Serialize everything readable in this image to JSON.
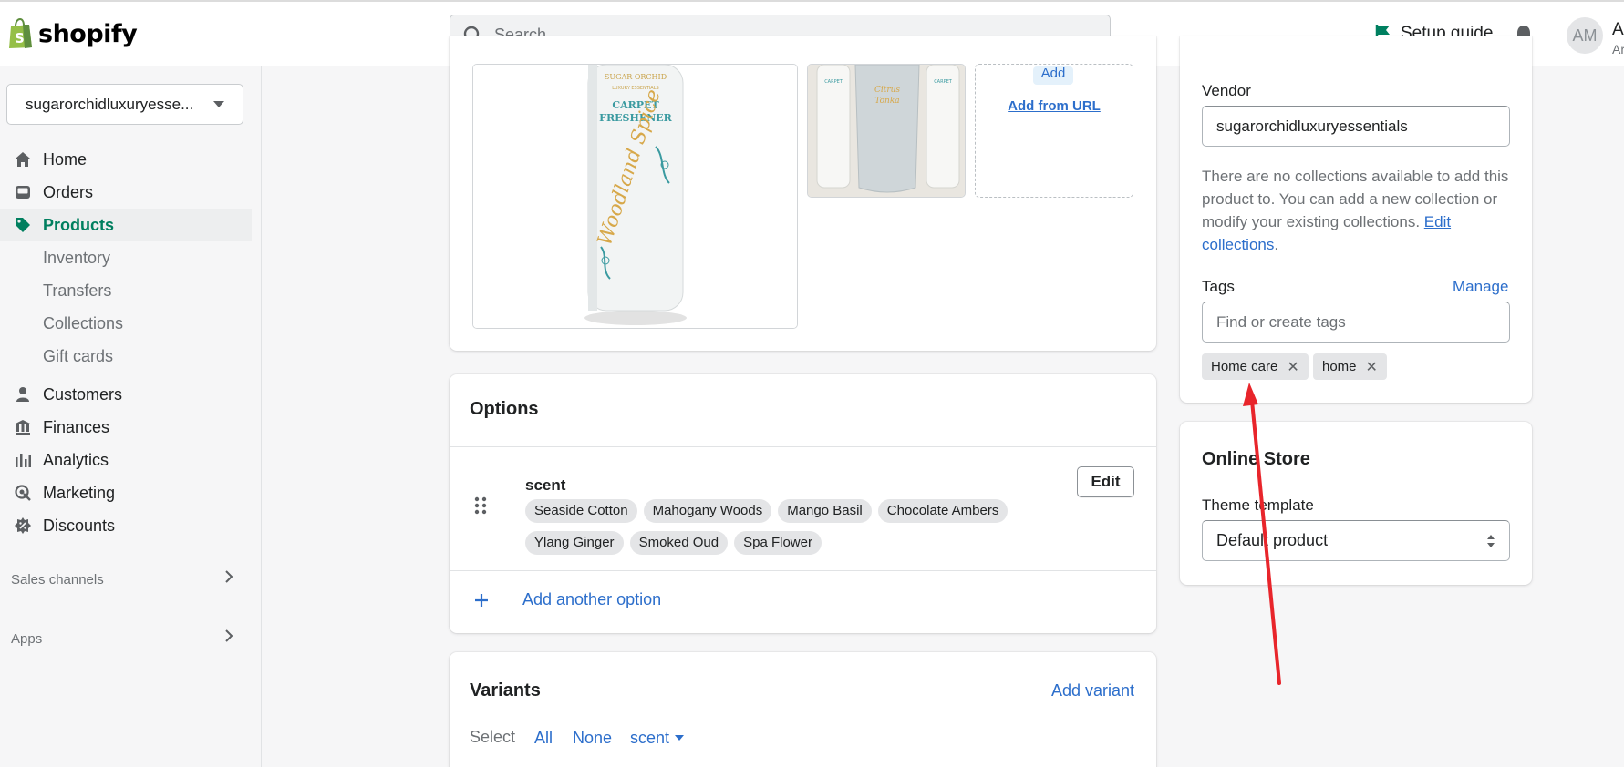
{
  "topbar": {
    "logo_text": "shopify",
    "search_placeholder": "Search",
    "setup_guide": "Setup guide",
    "avatar_initials": "AM",
    "user_initial": "A",
    "user_sub": "Ar"
  },
  "sidebar": {
    "store_name": "sugarorchidluxuryesse...",
    "items": [
      {
        "label": "Home",
        "icon": "home-icon"
      },
      {
        "label": "Orders",
        "icon": "orders-icon"
      },
      {
        "label": "Products",
        "icon": "tag-icon",
        "active": true
      },
      {
        "label": "Customers",
        "icon": "person-icon"
      },
      {
        "label": "Finances",
        "icon": "bank-icon"
      },
      {
        "label": "Analytics",
        "icon": "bar-chart-icon"
      },
      {
        "label": "Marketing",
        "icon": "target-icon"
      },
      {
        "label": "Discounts",
        "icon": "discount-icon"
      }
    ],
    "sub_items": [
      "Inventory",
      "Transfers",
      "Collections",
      "Gift cards"
    ],
    "sales_channels": "Sales channels",
    "apps": "Apps"
  },
  "media": {
    "add_badge": "Add",
    "add_from_url": "Add from URL",
    "product_image_text": {
      "brand": "SUGAR ORCHID",
      "brand_sub": "LUXURY ESSENTIALS",
      "product": "CARPET FRESHENER",
      "scent": "Woodland Spice"
    }
  },
  "options": {
    "title": "Options",
    "option_name": "scent",
    "edit_label": "Edit",
    "values_row1": [
      "Seaside Cotton",
      "Mahogany Woods",
      "Mango Basil",
      "Chocolate Ambers"
    ],
    "values_row2": [
      "Ylang Ginger",
      "Smoked Oud",
      "Spa Flower"
    ],
    "add_another": "Add another option"
  },
  "variants": {
    "title": "Variants",
    "add_variant": "Add variant",
    "select_label": "Select",
    "all": "All",
    "none": "None",
    "scent_filter": "scent"
  },
  "organization": {
    "vendor_label": "Vendor",
    "vendor_value": "sugarorchidluxuryessentials",
    "collections_help": "There are no collections available to add this product to. You can add a new collection or modify your existing collections.",
    "edit_collections": "Edit collections",
    "tags_label": "Tags",
    "manage": "Manage",
    "tags_placeholder": "Find or create tags",
    "tags": [
      "Home care",
      "home"
    ]
  },
  "online_store": {
    "title": "Online Store",
    "theme_template_label": "Theme template",
    "theme_template_value": "Default product"
  },
  "colors": {
    "accent_green": "#007f5f",
    "link_blue": "#2c6ecb",
    "annotation_red": "#e8252b"
  }
}
